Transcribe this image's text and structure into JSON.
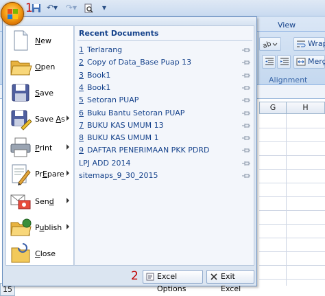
{
  "ribbon": {
    "view_tab": "View",
    "wrap_label": "Wrap",
    "merge_label": "Merge",
    "alignment_group": "Alignment"
  },
  "sheet": {
    "col_g": "G",
    "col_h": "H",
    "row_15": "15"
  },
  "markers": {
    "one": "1",
    "two": "2"
  },
  "menu": {
    "commands": [
      {
        "label": "New",
        "key": "N",
        "rest": "ew",
        "icon": "new-document-icon",
        "submenu": false
      },
      {
        "label": "Open",
        "key": "O",
        "rest": "pen",
        "icon": "open-folder-icon",
        "submenu": false
      },
      {
        "label": "Save",
        "key": "S",
        "rest": "ave",
        "icon": "save-disk-icon",
        "submenu": false
      },
      {
        "label": "Save As",
        "key": "A",
        "pre": "Save ",
        "rest": "s",
        "icon": "save-as-icon",
        "submenu": true
      },
      {
        "label": "Print",
        "key": "P",
        "rest": "rint",
        "icon": "printer-icon",
        "submenu": true
      },
      {
        "label": "Prepare",
        "key": "E",
        "pre": "Pr",
        "rest": "pare",
        "icon": "prepare-pencil-icon",
        "submenu": true
      },
      {
        "label": "Send",
        "key": "d",
        "pre": "Sen",
        "rest": "",
        "icon": "send-mail-icon",
        "submenu": true
      },
      {
        "label": "Publish",
        "key": "u",
        "pre": "P",
        "rest": "blish",
        "icon": "publish-folder-icon",
        "submenu": true
      },
      {
        "label": "Close",
        "key": "C",
        "rest": "lose",
        "icon": "close-folder-icon",
        "submenu": false
      }
    ],
    "recent_title": "Recent Documents",
    "recent": [
      {
        "num": "1",
        "name": "Terlarang"
      },
      {
        "num": "2",
        "name": "Copy of Data_Base Puap 13"
      },
      {
        "num": "3",
        "name": "Book1"
      },
      {
        "num": "4",
        "name": "Book1"
      },
      {
        "num": "5",
        "name": "Setoran PUAP"
      },
      {
        "num": "6",
        "name": "Buku Bantu Setoran PUAP"
      },
      {
        "num": "7",
        "name": "BUKU KAS UMUM 13"
      },
      {
        "num": "8",
        "name": "BUKU KAS UMUM 1"
      },
      {
        "num": "9",
        "name": "DAFTAR PENERIMAAN PKK PDRD"
      },
      {
        "num": "",
        "name": "LPJ ADD 2014"
      },
      {
        "num": "",
        "name": "sitemaps_9_30_2015"
      }
    ],
    "excel_options": "Excel Options",
    "exit_excel": "Exit Excel"
  },
  "colors": {
    "menu_bg": "#dbe5f1",
    "text_blue": "#15428b",
    "office_orange": "#f5a016",
    "marker_red": "#c00000"
  }
}
